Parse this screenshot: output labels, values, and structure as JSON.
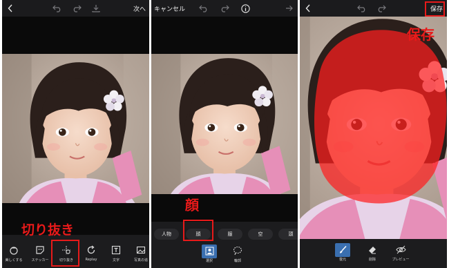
{
  "panel1": {
    "topbar": {
      "back_icon": "chevron-left-icon",
      "undo_icon": "undo-icon",
      "redo_icon": "redo-icon",
      "download_icon": "download-icon",
      "next_label": "次へ"
    },
    "tools": [
      {
        "label": "美しくする",
        "icon": "beautify-icon"
      },
      {
        "label": "ステッカー",
        "icon": "sticker-icon"
      },
      {
        "label": "切り抜き",
        "icon": "cutout-icon"
      },
      {
        "label": "Replay",
        "icon": "replay-icon"
      },
      {
        "label": "文字",
        "icon": "text-icon"
      },
      {
        "label": "写真の追",
        "icon": "add-photo-icon"
      }
    ],
    "annotation": "切り抜き"
  },
  "panel2": {
    "topbar": {
      "cancel_label": "キャンセル",
      "undo_icon": "undo-icon",
      "redo_icon": "redo-icon",
      "info_icon": "info-icon",
      "forward_icon": "arrow-right-icon"
    },
    "categories": [
      "人物",
      "顔",
      "服",
      "空",
      "頭"
    ],
    "selected_category": "顔",
    "tools": [
      {
        "label": "選択",
        "icon": "person-select-icon",
        "active": true
      },
      {
        "label": "輪郭",
        "icon": "lasso-icon",
        "active": false
      }
    ],
    "annotation": "顔"
  },
  "panel3": {
    "topbar": {
      "back_icon": "chevron-left-icon",
      "undo_icon": "undo-icon",
      "redo_icon": "redo-icon",
      "save_label": "保存"
    },
    "tools": [
      {
        "label": "復元",
        "icon": "brush-icon",
        "active": true
      },
      {
        "label": "削除",
        "icon": "eraser-icon",
        "active": false
      },
      {
        "label": "プレビュー",
        "icon": "preview-icon",
        "active": false
      }
    ],
    "annotation": "保存"
  },
  "colors": {
    "annotation_red": "#e81a1a",
    "active_blue": "#3a6fb0",
    "mask_red": "#ff1e1e"
  }
}
